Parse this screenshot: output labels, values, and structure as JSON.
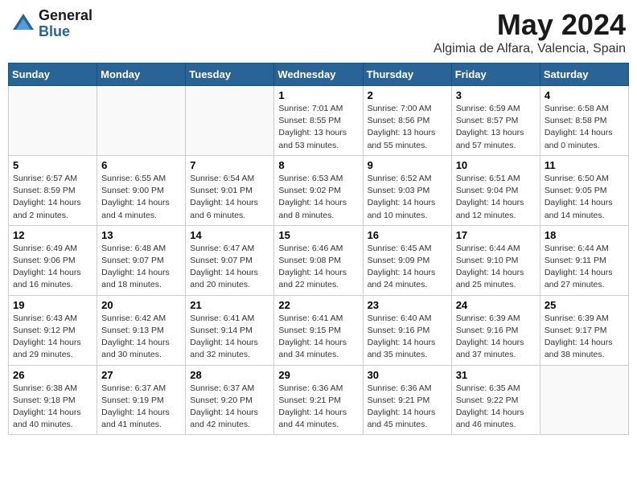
{
  "header": {
    "logo_general": "General",
    "logo_blue": "Blue",
    "month_title": "May 2024",
    "location": "Algimia de Alfara, Valencia, Spain"
  },
  "days_of_week": [
    "Sunday",
    "Monday",
    "Tuesday",
    "Wednesday",
    "Thursday",
    "Friday",
    "Saturday"
  ],
  "weeks": [
    [
      {
        "day": "",
        "info": ""
      },
      {
        "day": "",
        "info": ""
      },
      {
        "day": "",
        "info": ""
      },
      {
        "day": "1",
        "info": "Sunrise: 7:01 AM\nSunset: 8:55 PM\nDaylight: 13 hours\nand 53 minutes."
      },
      {
        "day": "2",
        "info": "Sunrise: 7:00 AM\nSunset: 8:56 PM\nDaylight: 13 hours\nand 55 minutes."
      },
      {
        "day": "3",
        "info": "Sunrise: 6:59 AM\nSunset: 8:57 PM\nDaylight: 13 hours\nand 57 minutes."
      },
      {
        "day": "4",
        "info": "Sunrise: 6:58 AM\nSunset: 8:58 PM\nDaylight: 14 hours\nand 0 minutes."
      }
    ],
    [
      {
        "day": "5",
        "info": "Sunrise: 6:57 AM\nSunset: 8:59 PM\nDaylight: 14 hours\nand 2 minutes."
      },
      {
        "day": "6",
        "info": "Sunrise: 6:55 AM\nSunset: 9:00 PM\nDaylight: 14 hours\nand 4 minutes."
      },
      {
        "day": "7",
        "info": "Sunrise: 6:54 AM\nSunset: 9:01 PM\nDaylight: 14 hours\nand 6 minutes."
      },
      {
        "day": "8",
        "info": "Sunrise: 6:53 AM\nSunset: 9:02 PM\nDaylight: 14 hours\nand 8 minutes."
      },
      {
        "day": "9",
        "info": "Sunrise: 6:52 AM\nSunset: 9:03 PM\nDaylight: 14 hours\nand 10 minutes."
      },
      {
        "day": "10",
        "info": "Sunrise: 6:51 AM\nSunset: 9:04 PM\nDaylight: 14 hours\nand 12 minutes."
      },
      {
        "day": "11",
        "info": "Sunrise: 6:50 AM\nSunset: 9:05 PM\nDaylight: 14 hours\nand 14 minutes."
      }
    ],
    [
      {
        "day": "12",
        "info": "Sunrise: 6:49 AM\nSunset: 9:06 PM\nDaylight: 14 hours\nand 16 minutes."
      },
      {
        "day": "13",
        "info": "Sunrise: 6:48 AM\nSunset: 9:07 PM\nDaylight: 14 hours\nand 18 minutes."
      },
      {
        "day": "14",
        "info": "Sunrise: 6:47 AM\nSunset: 9:07 PM\nDaylight: 14 hours\nand 20 minutes."
      },
      {
        "day": "15",
        "info": "Sunrise: 6:46 AM\nSunset: 9:08 PM\nDaylight: 14 hours\nand 22 minutes."
      },
      {
        "day": "16",
        "info": "Sunrise: 6:45 AM\nSunset: 9:09 PM\nDaylight: 14 hours\nand 24 minutes."
      },
      {
        "day": "17",
        "info": "Sunrise: 6:44 AM\nSunset: 9:10 PM\nDaylight: 14 hours\nand 25 minutes."
      },
      {
        "day": "18",
        "info": "Sunrise: 6:44 AM\nSunset: 9:11 PM\nDaylight: 14 hours\nand 27 minutes."
      }
    ],
    [
      {
        "day": "19",
        "info": "Sunrise: 6:43 AM\nSunset: 9:12 PM\nDaylight: 14 hours\nand 29 minutes."
      },
      {
        "day": "20",
        "info": "Sunrise: 6:42 AM\nSunset: 9:13 PM\nDaylight: 14 hours\nand 30 minutes."
      },
      {
        "day": "21",
        "info": "Sunrise: 6:41 AM\nSunset: 9:14 PM\nDaylight: 14 hours\nand 32 minutes."
      },
      {
        "day": "22",
        "info": "Sunrise: 6:41 AM\nSunset: 9:15 PM\nDaylight: 14 hours\nand 34 minutes."
      },
      {
        "day": "23",
        "info": "Sunrise: 6:40 AM\nSunset: 9:16 PM\nDaylight: 14 hours\nand 35 minutes."
      },
      {
        "day": "24",
        "info": "Sunrise: 6:39 AM\nSunset: 9:16 PM\nDaylight: 14 hours\nand 37 minutes."
      },
      {
        "day": "25",
        "info": "Sunrise: 6:39 AM\nSunset: 9:17 PM\nDaylight: 14 hours\nand 38 minutes."
      }
    ],
    [
      {
        "day": "26",
        "info": "Sunrise: 6:38 AM\nSunset: 9:18 PM\nDaylight: 14 hours\nand 40 minutes."
      },
      {
        "day": "27",
        "info": "Sunrise: 6:37 AM\nSunset: 9:19 PM\nDaylight: 14 hours\nand 41 minutes."
      },
      {
        "day": "28",
        "info": "Sunrise: 6:37 AM\nSunset: 9:20 PM\nDaylight: 14 hours\nand 42 minutes."
      },
      {
        "day": "29",
        "info": "Sunrise: 6:36 AM\nSunset: 9:21 PM\nDaylight: 14 hours\nand 44 minutes."
      },
      {
        "day": "30",
        "info": "Sunrise: 6:36 AM\nSunset: 9:21 PM\nDaylight: 14 hours\nand 45 minutes."
      },
      {
        "day": "31",
        "info": "Sunrise: 6:35 AM\nSunset: 9:22 PM\nDaylight: 14 hours\nand 46 minutes."
      },
      {
        "day": "",
        "info": ""
      }
    ]
  ]
}
